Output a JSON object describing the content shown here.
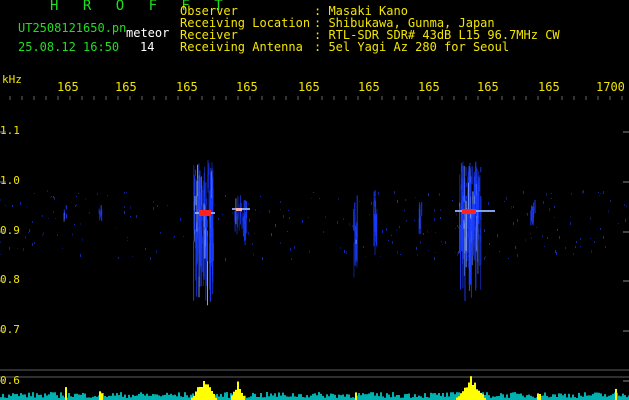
{
  "header": {
    "brand": "H R O F F T",
    "filename": "UT2508121650.pn",
    "kind": "meteor",
    "datetime": "25.08.12 16:50",
    "count": "14",
    "info": [
      {
        "label": "Observer",
        "value": ": Masaki Kano"
      },
      {
        "label": "Receiving Location",
        "value": ": Shibukawa, Gunma, Japan"
      },
      {
        "label": "Receiver",
        "value": ": RTL-SDR SDR# 43dB L15 96.7MHz CW"
      },
      {
        "label": "Receiving Antenna",
        "value": ": 5el Yagi Az 280 for Seoul"
      }
    ]
  },
  "axis": {
    "unit": "kHz",
    "y_labels": [
      "1.1",
      "1.0",
      "0.9",
      "0.8",
      "0.7",
      "0.6"
    ],
    "x_labels": [
      "165",
      "165",
      "165",
      "165",
      "165",
      "165",
      "165",
      "165",
      "165",
      "1700"
    ]
  },
  "colors": {
    "signal_blue": "#1a3cff",
    "core_red": "#ff2020",
    "histogram_yellow": "#ffff00",
    "histogram_cyan": "#00d0d0",
    "text_green": "#22dd22",
    "text_yellow": "#f2e600"
  }
}
